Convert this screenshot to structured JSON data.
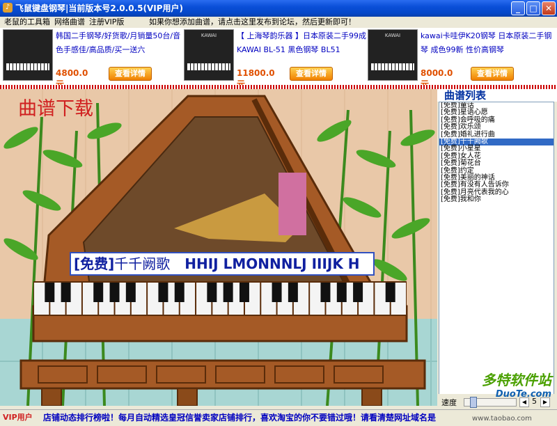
{
  "window": {
    "title": "飞鼠键盘钢琴|当前版本号2.0.0.5(VIP用户)",
    "icon": "app-icon"
  },
  "menu": {
    "items": [
      "老鼠的工具箱",
      "网络曲谱",
      "注册VIP版"
    ],
    "notice": "如果你想添加曲谱，请点击这里发布到论坛，然后更新即可！"
  },
  "ads": [
    {
      "desc": "韩国二手钢琴/好货歌/月销量50台/音色手感佳/高品质/买一送六",
      "price": "4800.0元",
      "button": "查看详情",
      "logo": ""
    },
    {
      "desc": "【 上海琴韵乐器 】日本原装二手99成 KAWAI BL-51 黑色钢琴 BL51",
      "price": "11800.0元",
      "button": "查看详情",
      "logo": "KAWAI"
    },
    {
      "desc": "kawai卡哇伊K20钢琴 日本原装二手钢琴 成色99新 性价高钢琴",
      "price": "8000.0元",
      "button": "查看详情",
      "logo": "KAWAI"
    }
  ],
  "scene": {
    "download_title": "曲谱下载",
    "now_playing": {
      "tag": "[免费]",
      "title": "千千阙歌",
      "notes": "HHIJ LMONNNLJ IIIJK H"
    }
  },
  "song_list": {
    "title": "曲谱列表",
    "items": [
      "[免费]童话",
      "[免费]星语心愿",
      "[免费]会呼吸的痛",
      "[免费]欢乐颂",
      "[免费]婚礼进行曲",
      "[免费]千千阙歌",
      "[免费]小星星",
      "[免费]女人花",
      "[免费]菊花台",
      "[免费]约定",
      "[免费]美丽的神话",
      "[免费]有没有人告诉你",
      "[免费]月亮代表我的心",
      "[免费]我和你"
    ],
    "selected_index": 5
  },
  "speed": {
    "label": "速度",
    "value": "5"
  },
  "status": {
    "vip": "VIP用户",
    "marquee": "店铺动态排行榜啦！每月自动精选皇冠信誉卖家店铺排行，喜欢淘宝的你不要错过哦！请看清楚网址域名是"
  },
  "watermark": {
    "brand": "多特软件站",
    "site": "DuoTe.com",
    "foot": "www.taobao.com"
  },
  "colors": {
    "title_bar": "#0a4fd8",
    "price": "#e05000",
    "list_selection": "#316ac5",
    "download_title": "#d02020",
    "status_text": "#0000c0"
  }
}
